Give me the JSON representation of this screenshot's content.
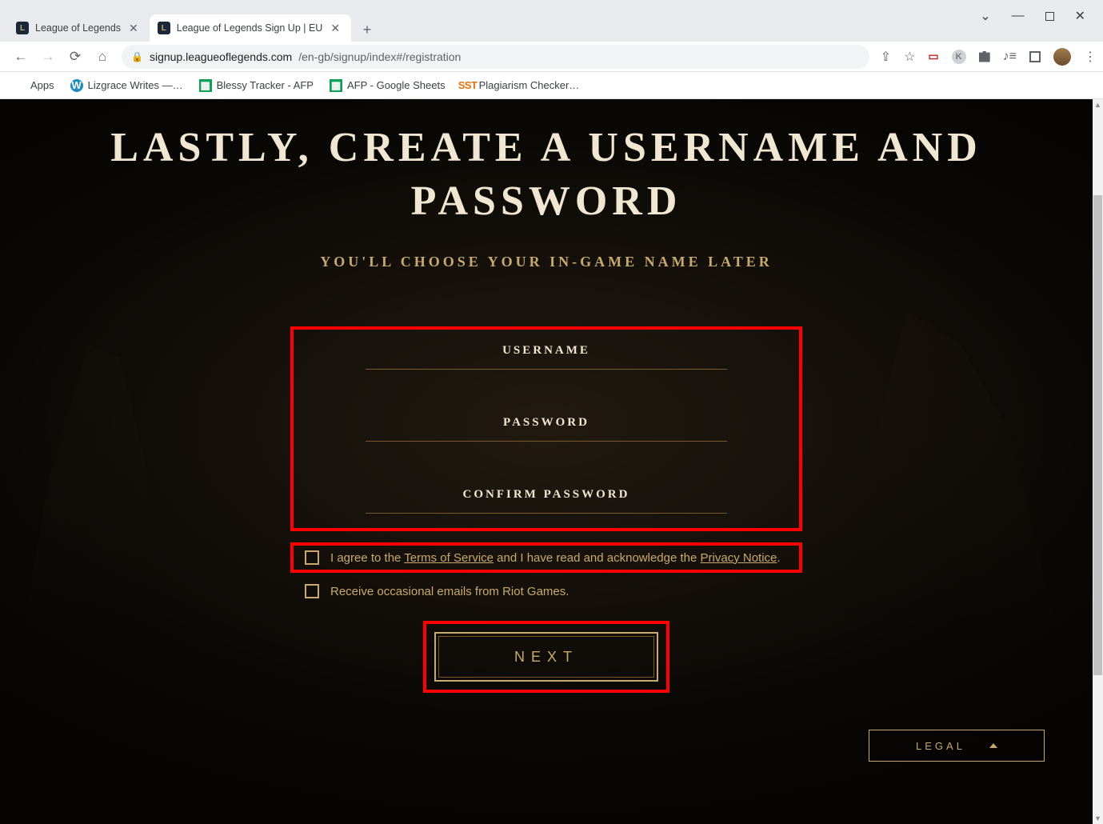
{
  "browser": {
    "tabs": [
      {
        "title": "League of Legends",
        "active": false
      },
      {
        "title": "League of Legends Sign Up | EU",
        "active": true
      }
    ],
    "address": {
      "host": "signup.leagueoflegends.com",
      "path": "/en-gb/signup/index#/registration"
    },
    "bookmarks": [
      {
        "label": "Apps",
        "icon": "apps"
      },
      {
        "label": "Lizgrace Writes —…",
        "icon": "wordpress"
      },
      {
        "label": "Blessy Tracker - AFP",
        "icon": "gsheet"
      },
      {
        "label": "AFP - Google Sheets",
        "icon": "gsheet"
      },
      {
        "label": "Plagiarism Checker…",
        "icon": "sst"
      }
    ]
  },
  "page": {
    "title": "LASTLY, CREATE A USERNAME AND PASSWORD",
    "subtitle": "YOU'LL CHOOSE YOUR IN-GAME NAME LATER",
    "fields": {
      "username_label": "USERNAME",
      "password_label": "PASSWORD",
      "confirm_label": "CONFIRM PASSWORD"
    },
    "terms": {
      "pre": "I agree to the ",
      "tos": "Terms of Service",
      "mid": " and I have read and acknowledge the ",
      "pn": "Privacy Notice",
      "end": "."
    },
    "emails_optin": "Receive occasional emails from Riot Games.",
    "next_label": "NEXT",
    "legal_label": "LEGAL"
  }
}
